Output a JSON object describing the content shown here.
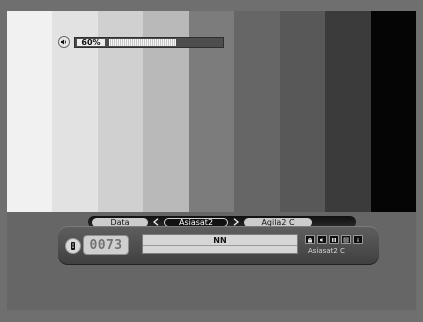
{
  "test_pattern": {
    "bar_colors": [
      "#f1f1f1",
      "#e2e2e2",
      "#d0d0d0",
      "#b9b9b9",
      "#7c7c7c",
      "#666666",
      "#585858",
      "#3b3b3b",
      "#050505"
    ]
  },
  "volume": {
    "level": 0.6,
    "label": "60%",
    "icon": "speaker-icon"
  },
  "channel_bar": {
    "tabs": {
      "left_label": "Data",
      "current": "Asiasat2",
      "right_label": "Agila2 C"
    },
    "channel_number": "0073",
    "channel_name": "NN",
    "satellite": "Asiasat2 C",
    "status_icons": [
      "scrambled-icon",
      "audio-icon",
      "dolby-icon",
      "teletext-icon",
      "info-icon"
    ],
    "remote_icon": "remote-control-icon"
  }
}
